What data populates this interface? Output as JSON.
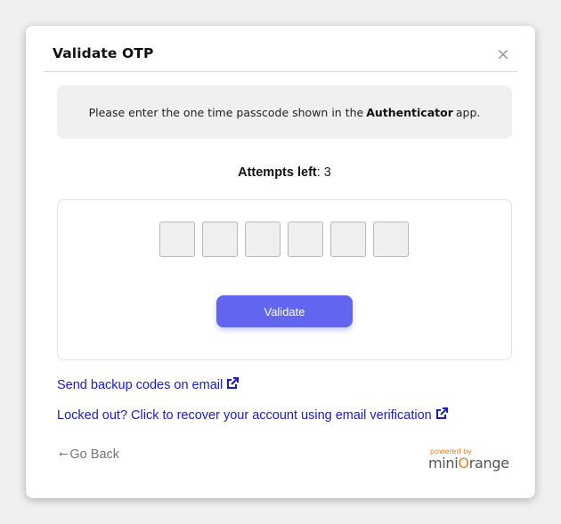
{
  "dialog": {
    "title": "Validate OTP",
    "close_symbol": "×",
    "close_icon": "close-icon"
  },
  "info": {
    "text_before": "Please enter the one time passcode shown in the",
    "app_name": "Authenticator",
    "text_after": "app."
  },
  "attempts": {
    "label": "Attempts left",
    "separator": ": ",
    "count": "3"
  },
  "otp": {
    "digits": [
      "",
      "",
      "",
      "",
      "",
      ""
    ],
    "validate_label": "Validate"
  },
  "links": {
    "backup_codes": "Send backup codes on email",
    "recover_account": "Locked out? Click to recover your account using email verification",
    "external_icon": "external-link-icon"
  },
  "footer": {
    "go_back_arrow": "⭠",
    "go_back_label": "Go Back",
    "powered_by": "powered by",
    "brand_start": "mini",
    "brand_o": "O",
    "brand_end": "range"
  },
  "colors": {
    "accent": "#6265f0",
    "link": "#1c1cc6",
    "brand_orange": "#f0802c"
  }
}
